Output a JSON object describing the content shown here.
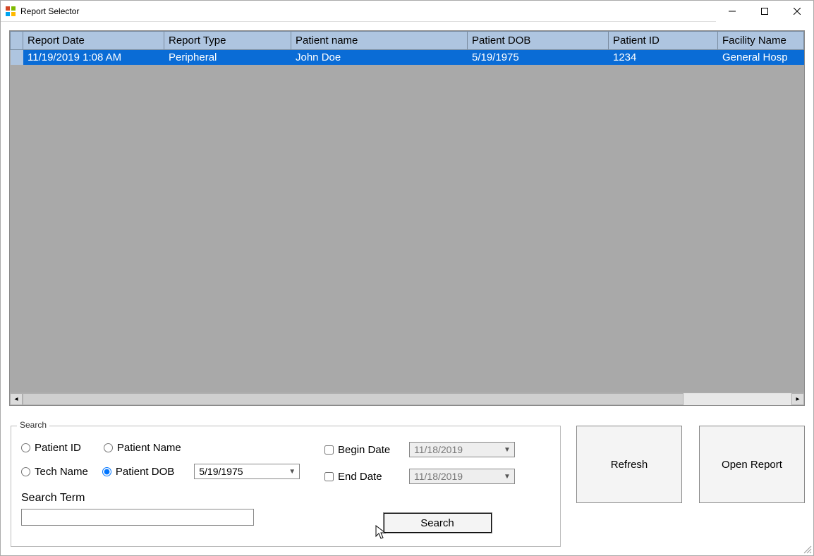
{
  "window": {
    "title": "Report Selector"
  },
  "grid": {
    "columns": [
      "Report Date",
      "Report Type",
      "Patient name",
      "Patient DOB",
      "Patient ID",
      "Facility Name"
    ],
    "rows": [
      {
        "report_date": "11/19/2019 1:08 AM",
        "report_type": "Peripheral",
        "patient_name": "John Doe",
        "patient_dob": "5/19/1975",
        "patient_id": "1234",
        "facility_name": "General Hosp"
      }
    ]
  },
  "search": {
    "legend": "Search",
    "radios": {
      "patient_id": "Patient ID",
      "patient_name": "Patient Name",
      "tech_name": "Tech Name",
      "patient_dob": "Patient DOB"
    },
    "dob_combo": "5/19/1975",
    "begin_date": {
      "label": "Begin Date",
      "value": "11/18/2019"
    },
    "end_date": {
      "label": "End Date",
      "value": "11/18/2019"
    },
    "search_term_label": "Search Term",
    "search_term_value": "",
    "search_button": "Search"
  },
  "buttons": {
    "refresh": "Refresh",
    "open_report": "Open Report"
  }
}
